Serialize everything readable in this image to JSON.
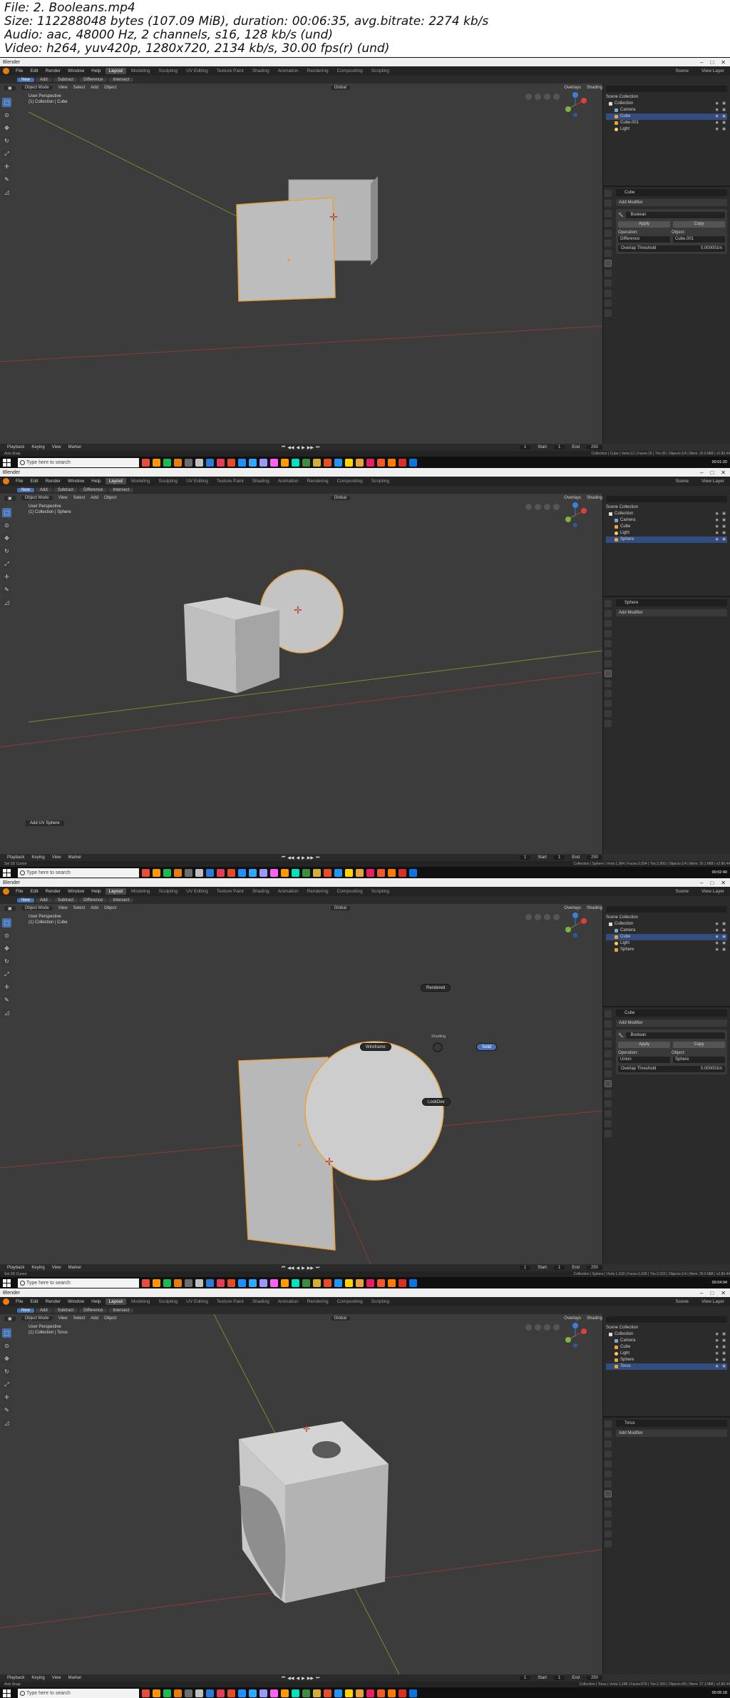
{
  "meta": {
    "file": "File: 2. Booleans.mp4",
    "size": "Size: 112288048 bytes (107.09 MiB), duration: 00:06:35, avg.bitrate: 2274 kb/s",
    "audio": "Audio: aac, 48000 Hz, 2 channels, s16, 128 kb/s (und)",
    "video": "Video: h264, yuv420p, 1280x720, 2134 kb/s, 30.00 fps(r) (und)"
  },
  "app": {
    "window_title": "Blender",
    "menu": [
      "File",
      "Edit",
      "Render",
      "Window",
      "Help"
    ],
    "workspaces": [
      "Layout",
      "Modeling",
      "Sculpting",
      "UV Editing",
      "Texture Paint",
      "Shading",
      "Animation",
      "Rendering",
      "Compositing",
      "Scripting"
    ],
    "scene_label": "Scene",
    "view_layer_label": "View Layer",
    "tool_modes": [
      "New",
      "Add",
      "Subtract",
      "Difference",
      "Intersect"
    ],
    "object_mode": "Object Mode",
    "view_menu": [
      "View",
      "Select",
      "Add",
      "Object"
    ],
    "orientation": "Global",
    "overlays": "Overlays",
    "shading": "Shading",
    "timeline_items": [
      "Playback",
      "Keying",
      "View",
      "Marker"
    ],
    "start_label": "Start",
    "end_label": "End",
    "current_frame": "1",
    "start_frame": "1",
    "end_frame": "250",
    "search_placeholder": "Type here to search",
    "scene_collection": "Scene Collection",
    "add_modifier": "Add Modifier",
    "apply_label": "Apply",
    "copy_label": "Copy",
    "operation_label": "Operation:",
    "object_label": "Object:",
    "overlap_label": "Overlap Threshold",
    "overlap_value": "0.000001m",
    "modifier_name": "Boolean"
  },
  "frames": [
    {
      "id": "frame-1",
      "viewport_perspective": "User Perspective",
      "viewport_collection": "(1) Collection | Cube",
      "outliner": [
        {
          "label": "Collection",
          "kind": "coll"
        },
        {
          "label": "Camera",
          "kind": "cam"
        },
        {
          "label": "Cube",
          "kind": "mesh",
          "selected": true
        },
        {
          "label": "Cube.001",
          "kind": "mesh"
        },
        {
          "label": "Light",
          "kind": "light"
        }
      ],
      "properties_object": "Cube",
      "has_modifier": true,
      "operation_value": "Difference",
      "object_value": "Cube.001",
      "timestamp": "00:01:20",
      "status_left": "Axis Snap",
      "status_right": "Collection | Cube | Verts:12 | Faces:15 | Tris:36 | Objects:1/4 | Mem: 25.6 MiB | v2.80.44"
    },
    {
      "id": "frame-2",
      "viewport_perspective": "User Perspective",
      "viewport_collection": "(1) Collection | Sphere",
      "outliner": [
        {
          "label": "Collection",
          "kind": "coll"
        },
        {
          "label": "Camera",
          "kind": "cam"
        },
        {
          "label": "Cube",
          "kind": "mesh"
        },
        {
          "label": "Light",
          "kind": "light"
        },
        {
          "label": "Sphere",
          "kind": "mesh",
          "selected": true
        }
      ],
      "properties_object": "Sphere",
      "has_modifier": false,
      "operation_value": "",
      "object_value": "",
      "operator_panel": "Add UV Sphere",
      "timestamp": "00:02:40",
      "status_left": "Set 3D Cursor",
      "status_right": "Collection | Sphere | Verts:1,994 | Faces:2,054 | Tris:3,900 | Objects:1/4 | Mem: 25.1 MiB | v2.80.44"
    },
    {
      "id": "frame-3",
      "viewport_perspective": "User Perspective",
      "viewport_collection": "(1) Collection | Cube",
      "outliner": [
        {
          "label": "Collection",
          "kind": "coll"
        },
        {
          "label": "Camera",
          "kind": "cam"
        },
        {
          "label": "Cube",
          "kind": "mesh",
          "selected": true
        },
        {
          "label": "Light",
          "kind": "light"
        },
        {
          "label": "Sphere",
          "kind": "mesh"
        }
      ],
      "properties_object": "Cube",
      "has_modifier": true,
      "operation_value": "Union",
      "object_value": "Sphere",
      "pie_menu": {
        "title": "Shading",
        "rendered": "Rendered",
        "wireframe": "Wireframe",
        "solid": "Solid",
        "lookdev": "LookDev"
      },
      "timestamp": "00:04:04",
      "status_left": "Set 3D Cursor",
      "status_right": "Collection | Sphere | Verts:1,018 | Faces:1,026 | Tris:2,022 | Objects:1/4 | Mem: 25.5 MiB | v2.80.44"
    },
    {
      "id": "frame-4",
      "viewport_perspective": "User Perspective",
      "viewport_collection": "(1) Collection | Torus",
      "outliner": [
        {
          "label": "Collection",
          "kind": "coll"
        },
        {
          "label": "Camera",
          "kind": "cam"
        },
        {
          "label": "Cube",
          "kind": "mesh"
        },
        {
          "label": "Light",
          "kind": "light"
        },
        {
          "label": "Sphere",
          "kind": "mesh"
        },
        {
          "label": "Torus",
          "kind": "mesh",
          "selected": true
        }
      ],
      "properties_object": "Torus",
      "has_modifier": false,
      "operation_value": "",
      "object_value": "",
      "timestamp": "00:05:18",
      "status_left": "Axis Snap",
      "status_right": "Collection | Torus | Verts:1,248 | Faces:876 | Tris:2,300 | Objects:0/5 | Mem: 27.3 MiB | v2.80.44"
    }
  ]
}
